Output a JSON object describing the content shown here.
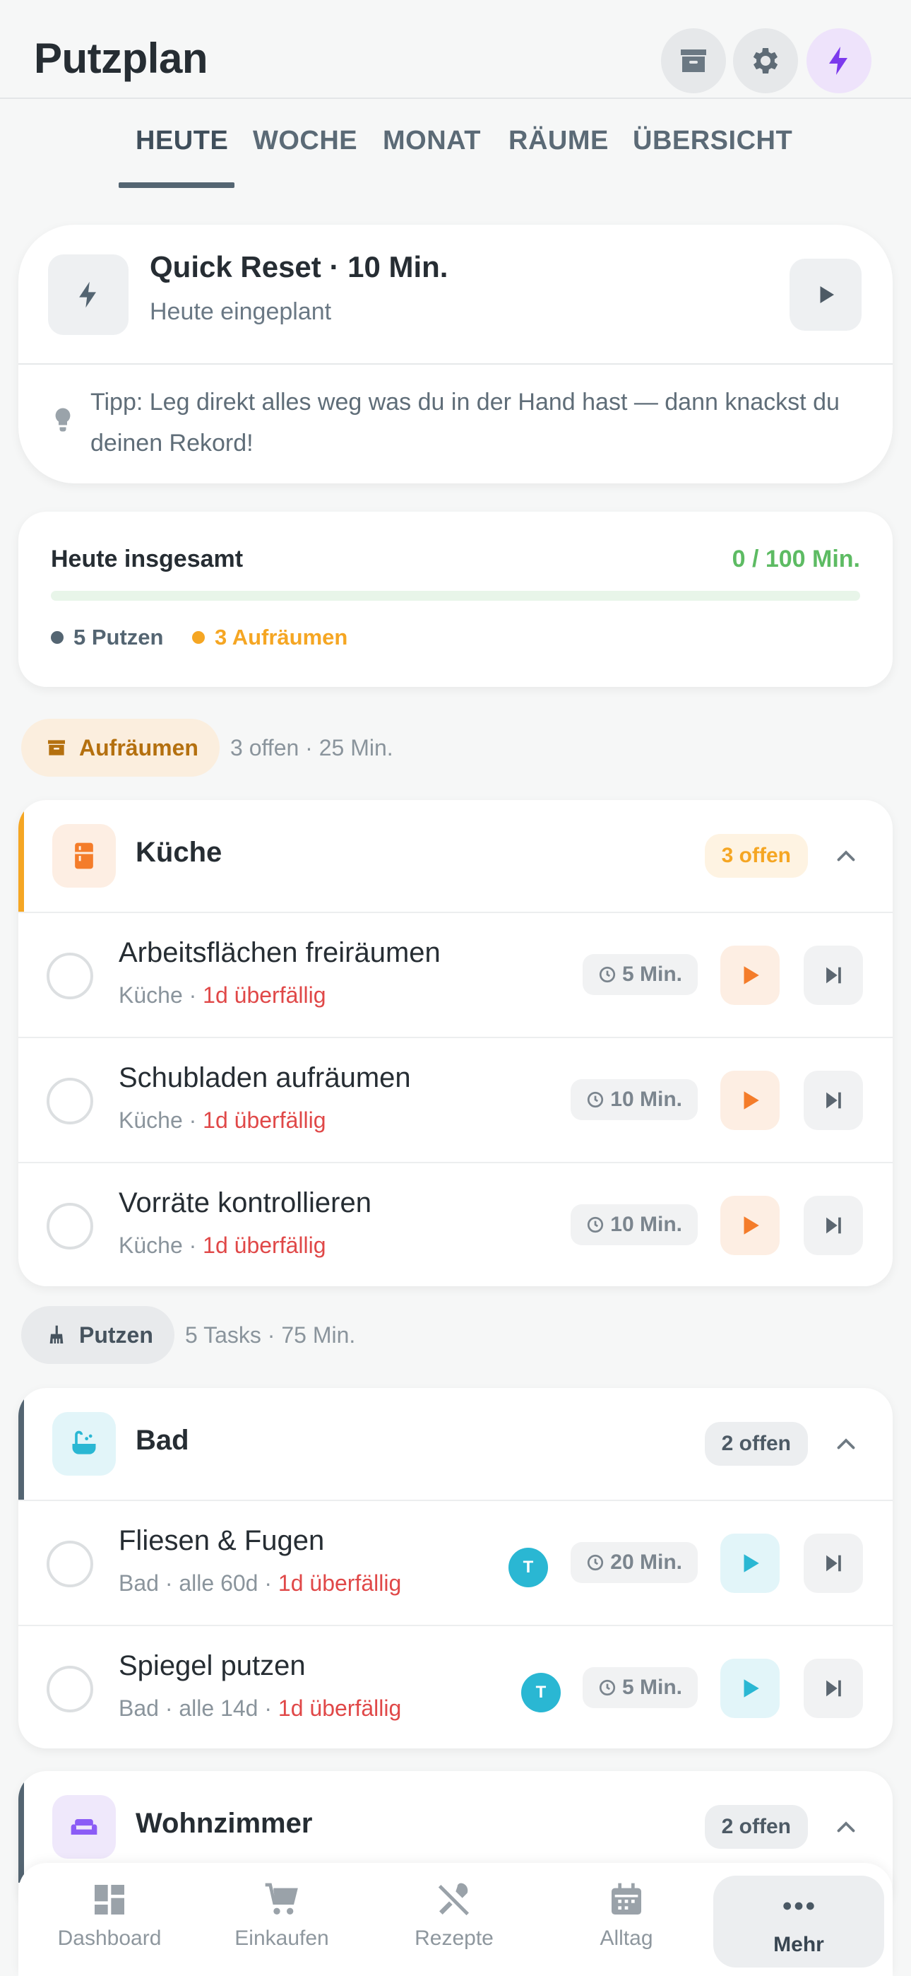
{
  "header": {
    "title": "Putzplan"
  },
  "tabs": [
    "HEUTE",
    "WOCHE",
    "MONAT",
    "RÄUME",
    "ÜBERSICHT"
  ],
  "quick_reset": {
    "title": "Quick Reset · 10 Min.",
    "subtitle": "Heute eingeplant",
    "tip": "Tipp: Leg direkt alles weg was du in der Hand hast — dann knackst du deinen Rekord!"
  },
  "summary": {
    "title": "Heute insgesamt",
    "value": "0 / 100 Min.",
    "progress": 0,
    "legend": [
      {
        "label": "5 Putzen",
        "color": "#546572"
      },
      {
        "label": "3 Aufräumen",
        "color": "#f5a623"
      }
    ]
  },
  "sections": {
    "aufraeumen": {
      "label": "Aufräumen",
      "meta": "3 offen · 25 Min."
    },
    "putzen": {
      "label": "Putzen",
      "meta": "5 Tasks · 75 Min."
    }
  },
  "rooms": {
    "kueche": {
      "name": "Küche",
      "badge": "3 offen",
      "tasks": [
        {
          "name": "Arbeitsflächen freiräumen",
          "room": "Küche · ",
          "overdue": "1d überfällig",
          "duration": "5 Min."
        },
        {
          "name": "Schubladen aufräumen",
          "room": "Küche · ",
          "overdue": "1d überfällig",
          "duration": "10 Min."
        },
        {
          "name": "Vorräte kontrollieren",
          "room": "Küche · ",
          "overdue": "1d überfällig",
          "duration": "10 Min."
        }
      ]
    },
    "bad": {
      "name": "Bad",
      "badge": "2 offen",
      "tasks": [
        {
          "name": "Fliesen & Fugen",
          "room": "Bad · alle 60d · ",
          "overdue": "1d überfällig",
          "duration": "20 Min.",
          "avatar": "T"
        },
        {
          "name": "Spiegel putzen",
          "room": "Bad · alle 14d · ",
          "overdue": "1d überfällig",
          "duration": "5 Min.",
          "avatar": "T"
        }
      ]
    },
    "wohnzimmer": {
      "name": "Wohnzimmer",
      "badge": "2 offen"
    }
  },
  "nav": [
    "Dashboard",
    "Einkaufen",
    "Rezepte",
    "Alltag",
    "Mehr"
  ],
  "colors": {
    "accent_purple": "#7c3aed",
    "kitchen_orange": "#f47c2a",
    "bath_cyan": "#2ab7d3",
    "overdue_red": "#e04848",
    "success_green": "#5dbb63"
  }
}
